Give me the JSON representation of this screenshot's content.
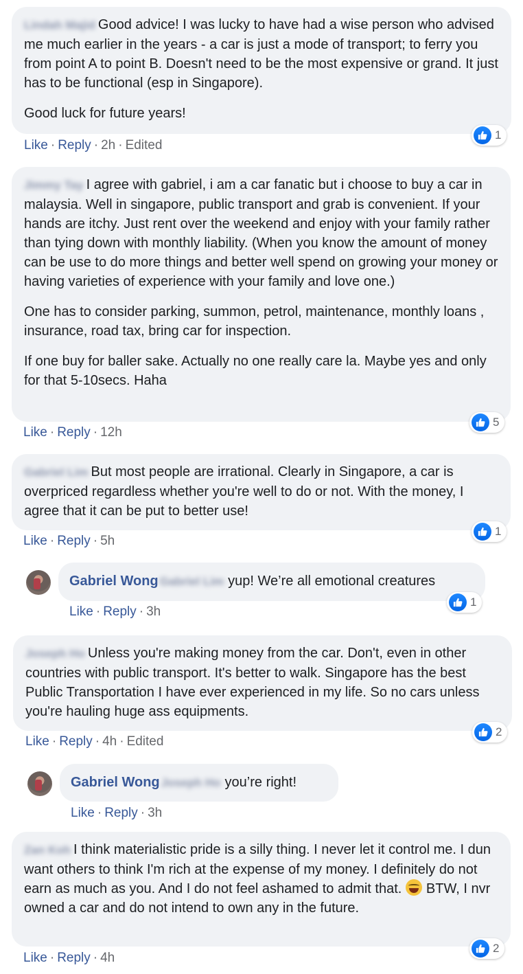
{
  "comments": [
    {
      "author": "Lindah Majid",
      "paragraphs": [
        "Good advice! I was lucky to have had a wise person who advised me much earlier in the years - a car is just a mode of transport; to ferry you from point A to point B. Doesn't need to be the most expensive or grand. It just has to be functional (esp in Singapore).",
        "Good luck for future years!"
      ],
      "like": "Like",
      "reply": "Reply",
      "time": "2h",
      "edited": "Edited",
      "reactions": "1"
    },
    {
      "author": "Jimmy Tay",
      "paragraphs": [
        "I agree with gabriel, i am a car fanatic but i choose to buy a car in malaysia. Well in singapore, public transport and grab is convenient. If your hands are itchy. Just rent over the weekend and enjoy with your family rather than tying down with monthly liability. (When you know the amount of money can be use to do more things and better well spend on growing your money or having varieties of experience with your family and love one.)",
        "One has to consider parking, summon, petrol, maintenance, monthly loans , insurance, road tax, bring car for inspection.",
        "If one buy for baller sake. Actually no one really care la. Maybe yes and only for that 5-10secs. Haha"
      ],
      "like": "Like",
      "reply": "Reply",
      "time": "12h",
      "reactions": "5"
    },
    {
      "author": "Gabriel Lim",
      "paragraphs": [
        "But most people are irrational. Clearly in Singapore, a car is overpriced regardless whether you're well to do or not. With the money, I agree that it can be put to better use!"
      ],
      "like": "Like",
      "reply": "Reply",
      "time": "5h",
      "reactions": "1"
    },
    {
      "author": "Gabriel Wong",
      "mention": "Gabriel Lim",
      "text": "yup! We’re all emotional creatures",
      "like": "Like",
      "reply": "Reply",
      "time": "3h",
      "reactions": "1"
    },
    {
      "author": "Joseph Ho",
      "paragraphs": [
        "Unless you're making money from the car. Don't, even in other countries with public transport. It's better to walk. Singapore has the best Public Transportation I have ever experienced in my life. So no cars unless you're hauling huge ass equipments."
      ],
      "like": "Like",
      "reply": "Reply",
      "time": "4h",
      "edited": "Edited",
      "reactions": "2"
    },
    {
      "author": "Gabriel Wong",
      "mention": "Joseph Ho",
      "text": "you’re right!",
      "like": "Like",
      "reply": "Reply",
      "time": "3h"
    },
    {
      "author": "Zan Koh",
      "text_before_emoji": "I think materialistic pride is a silly thing. I never let it control me. I dun want others to think I'm rich at the expense of my money. I definitely do not earn as much as you. And I do not feel ashamed to admit that.",
      "emoji": "grinning-tears-emoji",
      "text_after_emoji": "BTW, I nvr owned a car and do not intend to own any in the future.",
      "like": "Like",
      "reply": "Reply",
      "time": "4h",
      "reactions": "2"
    }
  ],
  "colors": {
    "bubble": "#f0f2f5",
    "link": "#385898",
    "meta": "#65676b",
    "like_blue": "#1877f2"
  }
}
